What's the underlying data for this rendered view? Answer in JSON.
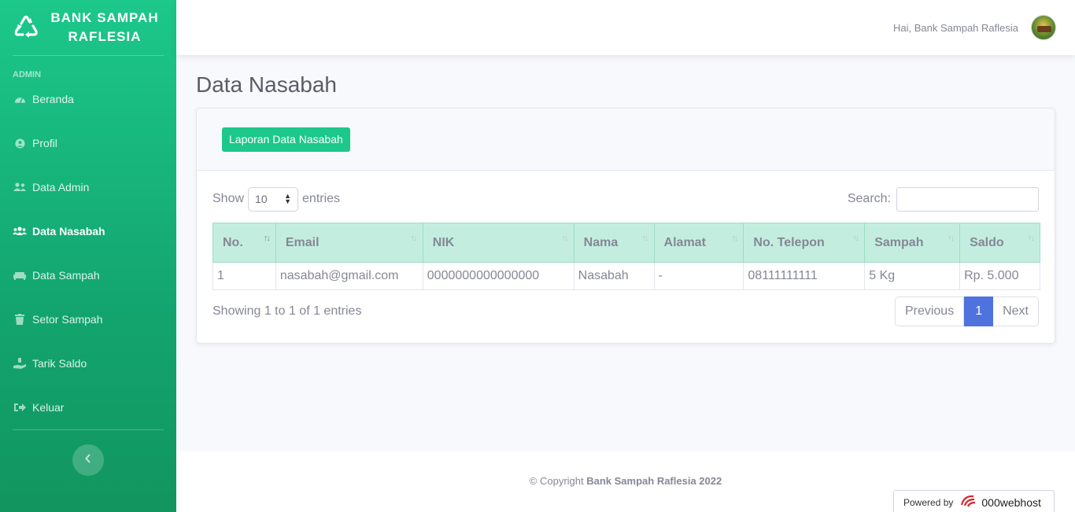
{
  "sidebar": {
    "brand_line1": "BANK SAMPAH",
    "brand_line2": "RAFLESIA",
    "heading": "ADMIN",
    "items": [
      {
        "label": "Beranda",
        "icon": "tachometer-icon"
      },
      {
        "label": "Profil",
        "icon": "user-circle-icon"
      },
      {
        "label": "Data Admin",
        "icon": "user-friends-icon"
      },
      {
        "label": "Data Nasabah",
        "icon": "users-icon",
        "active": true
      },
      {
        "label": "Data Sampah",
        "icon": "couch-icon"
      },
      {
        "label": "Setor Sampah",
        "icon": "trash-icon"
      },
      {
        "label": "Tarik Saldo",
        "icon": "hand-holding-icon"
      },
      {
        "label": "Keluar",
        "icon": "sign-out-icon"
      }
    ]
  },
  "topbar": {
    "greeting": "Hai, Bank Sampah Raflesia"
  },
  "page": {
    "title": "Data Nasabah"
  },
  "card": {
    "report_button": "Laporan Data Nasabah",
    "show_label": "Show",
    "show_value": "10",
    "entries_label": "entries",
    "search_label": "Search:",
    "search_value": "",
    "columns": [
      "No.",
      "Email",
      "NIK",
      "Nama",
      "Alamat",
      "No. Telepon",
      "Sampah",
      "Saldo"
    ],
    "rows": [
      [
        "1",
        "nasabah@gmail.com",
        "0000000000000000",
        "Nasabah",
        "-",
        "08111111111",
        "5 Kg",
        "Rp. 5.000"
      ]
    ],
    "info": "Showing 1 to 1 of 1 entries",
    "pagination": {
      "previous": "Previous",
      "current": "1",
      "next": "Next"
    }
  },
  "footer": {
    "copyright_prefix": "© Copyright",
    "copyright_name": "Bank Sampah Raflesia 2022",
    "powered_by": "Powered by",
    "host": "000webhost"
  },
  "colors": {
    "primary_green": "#1cc88a",
    "accent_blue": "#4e73df"
  }
}
